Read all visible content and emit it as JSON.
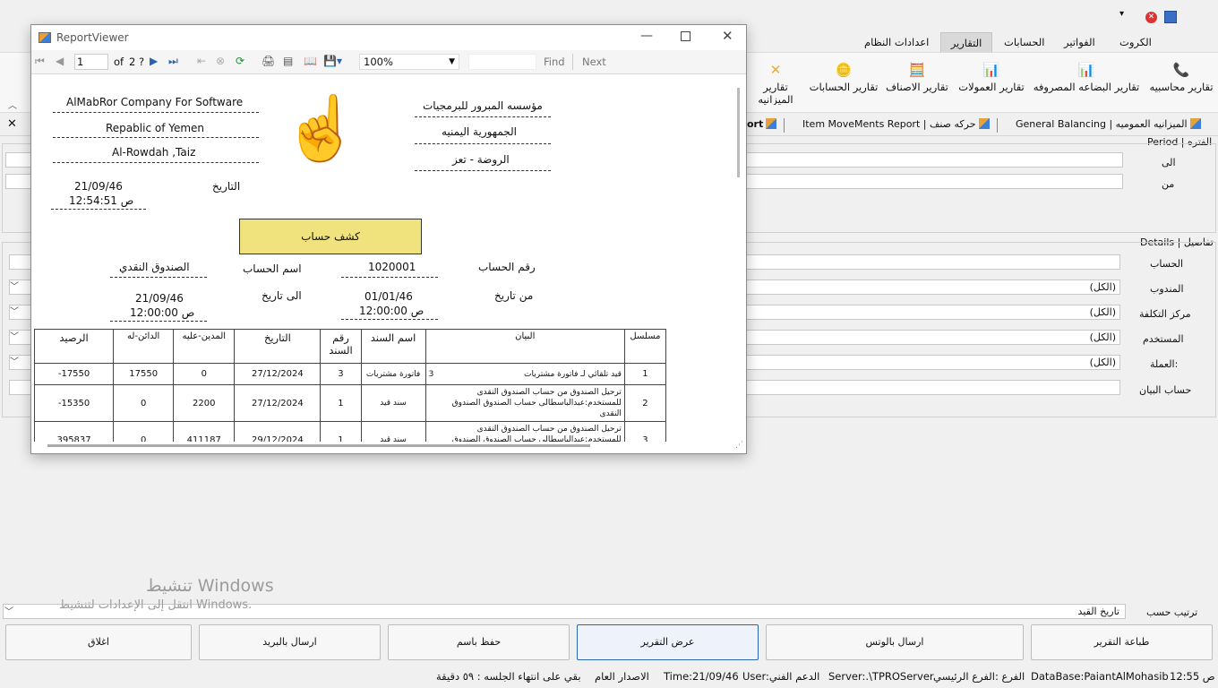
{
  "app": {
    "tabs": [
      "الكروت",
      "التقارير",
      "الحسابات",
      "الفواتير",
      "اعدادات النظام"
    ],
    "tabs_display": {
      "cards": "الكروت",
      "invoices": "الفواتير",
      "accounts": "الحسابات",
      "reports": "التقارير",
      "settings": "اعدادات النظام"
    },
    "ribbon": {
      "accounting": "تقارير محاسبيه",
      "goods_out": "تقارير البضاعه المصروفه",
      "commissions": "تقارير العمولات",
      "items": "تقارير الاصناف",
      "accounts": "تقارير الحسابات",
      "balance": "تقارير الميزانيه"
    },
    "report_tabs": {
      "general_balancing": "General Balancing | الميزانيه العموميه",
      "item_movements": "Item MoveMents Report | حركه صنف",
      "report": "ort"
    },
    "filters": {
      "period_label": "Period | الفتره",
      "to_label": "الى",
      "from_label": "من",
      "details_label": "Details | تفاصيل",
      "account_label": "الحساب",
      "rep_label": "المندوب",
      "cost_center_label": "مركز التكلفة",
      "user_label": "المستخدم",
      "currency_label": "العملة:",
      "statement_label": "حساب البيان",
      "all_value": "(الكل)",
      "sort_label": "ترتيب حسب",
      "sort_value": "تاريخ القيد"
    },
    "buttons": {
      "print": "طباعة التقرير",
      "whatsapp": "ارسال بالوتس",
      "show": "عرض التقرير",
      "save_as": "حفظ باسم",
      "email": "ارسال بالبريد",
      "close": "اغلاق"
    },
    "watermark": {
      "line1": "تنشيط Windows",
      "line2": "انتقل إلى الإعدادات لتنشيط Windows."
    },
    "status": {
      "time": "ص 12:55",
      "database": "DataBase:PaiantAlMohasib",
      "branch": "الفرع :الفرع الرئيسي",
      "server": "Server:.\\TPROServer",
      "user": "User:الدعم الفني",
      "date": "Time:21/09/46",
      "edition": "الاصدار العام",
      "session": "بقي على انتهاء الجلسه : ٥٩ دقيقة"
    }
  },
  "viewer": {
    "title": "ReportViewer",
    "page": "1",
    "of_label": "of",
    "total_pages": "2 ?",
    "zoom": "100%",
    "find": "Find",
    "next": "Next",
    "header": {
      "company_en": "AlMabRor Company For Software",
      "country_en": "Repablic of Yemen",
      "city_en": "Al-Rowdah ,Taiz",
      "company_ar": "مؤسسه المبرور للبرمجيات",
      "country_ar": "الجمهورية اليمنيه",
      "city_ar": "الروضة - تعز",
      "date_label": "التاريخ",
      "date": "21/09/46",
      "time": "ص 12:54:51",
      "report_title": "كشف حساب",
      "acc_no_label": "رقم الحساب",
      "acc_no": "1020001",
      "acc_name_label": "اسم الحساب",
      "acc_name": "الصندوق النقدي",
      "from_label": "من تاريخ",
      "from_date": "01/01/46",
      "from_time": "ص 12:00:00",
      "to_label": "الى تاريخ",
      "to_date": "21/09/46",
      "to_time": "ص 12:00:00"
    },
    "columns": [
      "الرصيد",
      "الدائن-له",
      "المدين-عليه",
      "التاريخ",
      "رقم السند",
      "اسم السند",
      "البيان",
      "مسلسل"
    ],
    "rows": [
      {
        "balance": "-17550",
        "credit": "17550",
        "debit": "0",
        "date": "27/12/2024",
        "doc_no": "3",
        "doc_name": "فاتورة مشتريات",
        "desc": "قيد تلقائي لـ فاتورة مشتريات",
        "desc_no": "3",
        "serial": "1"
      },
      {
        "balance": "-15350",
        "credit": "0",
        "debit": "2200",
        "date": "27/12/2024",
        "doc_no": "1",
        "doc_name": "سند قيد",
        "desc": "ترحيل الصندوق من حساب الصندوق النقدى",
        "desc2": "للمستخدم:عبدالباسطالى حساب الصندوق الصندوق النقدى",
        "serial": "2"
      },
      {
        "balance": "395837",
        "credit": "0",
        "debit": "411187",
        "date": "29/12/2024",
        "doc_no": "1",
        "doc_name": "سند قيد",
        "desc": "ترحيل الصندوق من حساب الصندوق النقدى",
        "desc2": "للمستخدم:عبدالباسطالى حساب الصندوق الصندوق النقدى",
        "serial": "3"
      }
    ]
  }
}
